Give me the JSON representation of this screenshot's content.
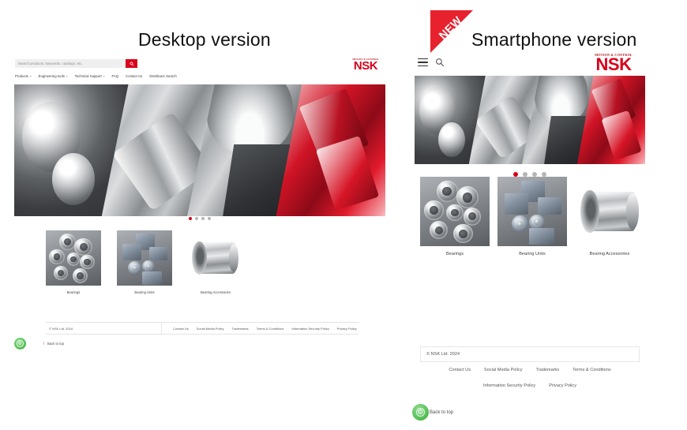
{
  "page": {
    "desktop_caption": "Desktop version",
    "phone_caption": "Smartphone version",
    "new_badge": "NEW",
    "accent_red": "#d8021a",
    "badge_red": "#e8212e",
    "green": "#5cc45c"
  },
  "brand": {
    "tagline": "MOTION & CONTROL",
    "name": "NSK"
  },
  "desktop": {
    "search": {
      "placeholder": "Search products, keywords, catalogs, etc.",
      "value": "",
      "button_icon": "search-icon"
    },
    "nav": [
      {
        "label": "Products",
        "has_caret": true
      },
      {
        "label": "Engineering tools",
        "has_caret": true
      },
      {
        "label": "Technical Support",
        "has_caret": true
      },
      {
        "label": "FAQ",
        "has_caret": false
      },
      {
        "label": "Contact Us",
        "has_caret": false
      },
      {
        "label": "Distributor Search",
        "has_caret": false
      }
    ],
    "carousel": {
      "slides": 4,
      "active": 1
    },
    "cards": [
      {
        "label": "Bearings",
        "kind": "bearings"
      },
      {
        "label": "Bearing Units",
        "kind": "units"
      },
      {
        "label": "Bearing Accessories",
        "kind": "accessory"
      }
    ],
    "footer": {
      "copyright": "© NSK Ltd. 2024",
      "links": [
        "Contact Us",
        "Social Media Policy",
        "Trademarks",
        "Terms & Conditions",
        "Information Security Policy",
        "Privacy Policy"
      ]
    },
    "back_to_top": {
      "label": "Back to top",
      "arrow_icon": "arrow-up-icon",
      "badge_icon": "accessibility-badge-icon"
    }
  },
  "phone": {
    "menu_icon": "hamburger-menu-icon",
    "search_icon": "search-icon",
    "carousel": {
      "slides": 4,
      "active": 1
    },
    "cards": [
      {
        "label": "Bearings",
        "kind": "bearings"
      },
      {
        "label": "Bearing Units",
        "kind": "units"
      },
      {
        "label": "Bearing Accessories",
        "kind": "accessory"
      }
    ],
    "footer": {
      "copyright": "© NSK Ltd. 2024",
      "links_row1": [
        "Contact Us",
        "Social Media Policy",
        "Trademarks",
        "Terms & Conditions"
      ],
      "links_row2": [
        "Information Security Policy",
        "Privacy Policy"
      ]
    },
    "back_to_top": {
      "label": "Back to top",
      "badge_icon": "accessibility-badge-icon"
    }
  }
}
